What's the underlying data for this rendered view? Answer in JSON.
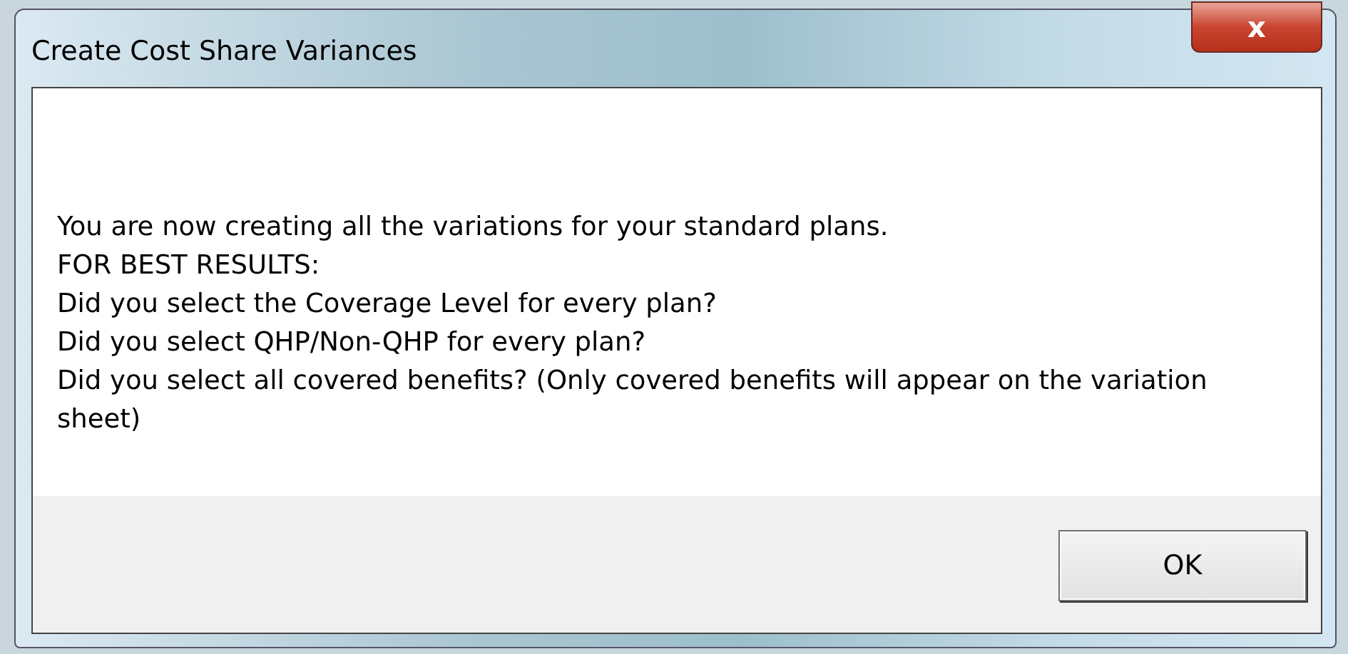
{
  "window": {
    "title": "Create Cost Share Variances"
  },
  "message": [
    "You are now creating all the variations for your standard plans.",
    "FOR BEST RESULTS:",
    "Did you select the Coverage Level for every plan?",
    "Did you select QHP/Non-QHP for every plan?",
    "Did you select all covered benefits? (Only covered benefits will appear on the variation sheet)"
  ],
  "buttons": [
    "OK"
  ],
  "close_button": "x"
}
